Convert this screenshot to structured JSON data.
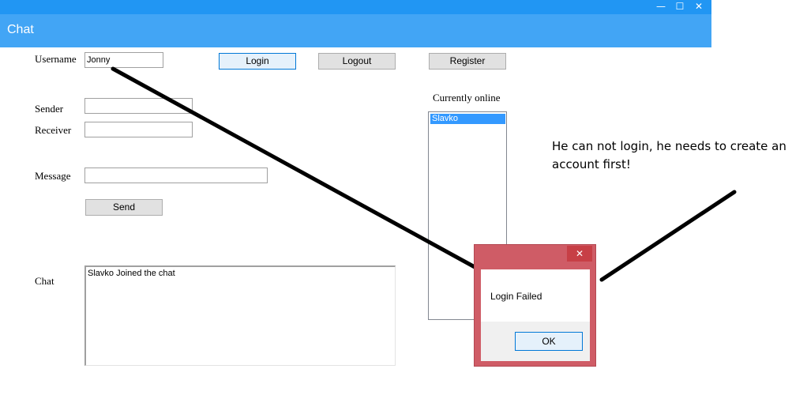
{
  "window": {
    "title": "Chat",
    "controls": {
      "minimize_icon": "minimize-icon",
      "maximize_icon": "maximize-icon",
      "close_icon": "close-icon"
    },
    "colors": {
      "titlebar": "#2196f3",
      "appbar": "#42a5f5"
    }
  },
  "form": {
    "username_label": "Username",
    "username_value": "Jonny",
    "login_label": "Login",
    "logout_label": "Logout",
    "register_label": "Register",
    "sender_label": "Sender",
    "sender_value": "",
    "receiver_label": "Receiver",
    "receiver_value": "",
    "message_label": "Message",
    "message_value": "",
    "send_label": "Send",
    "chat_label": "Chat",
    "chat_log": "Slavko Joined the chat"
  },
  "online": {
    "label": "Currently online",
    "users": [
      "Slavko"
    ]
  },
  "dialog": {
    "message": "Login Failed",
    "ok_label": "OK",
    "close_glyph": "✕"
  },
  "annotation": {
    "text": "He can not login, he needs to create an account first!"
  }
}
